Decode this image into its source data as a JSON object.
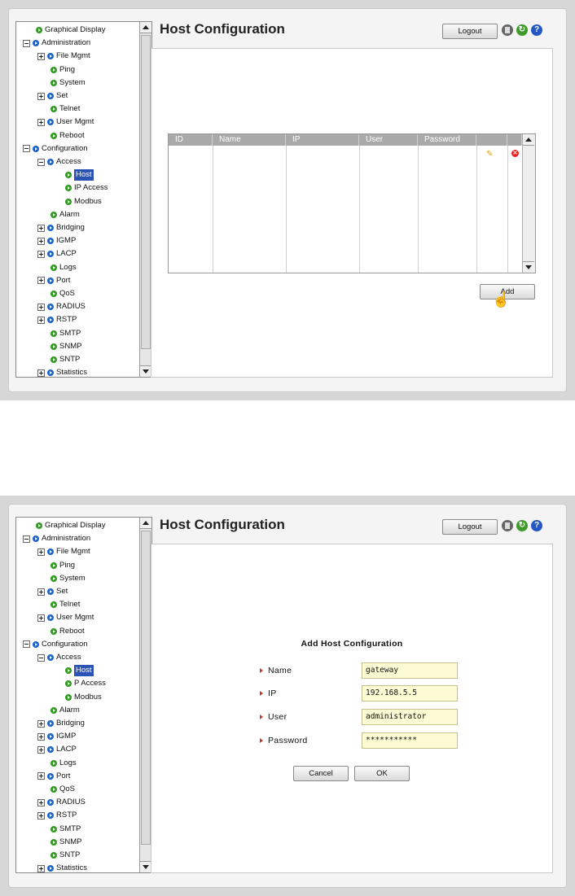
{
  "page": {
    "title": "Host Configuration",
    "logout_label": "Logout"
  },
  "tree": [
    {
      "label": "Graphical Display",
      "level": 0,
      "dot": "green"
    },
    {
      "label": "Administration",
      "level": 0,
      "dot": "blue",
      "toggle": "minus"
    },
    {
      "label": "File Mgmt",
      "level": 1,
      "dot": "blue",
      "toggle": "plus"
    },
    {
      "label": "Ping",
      "level": 1,
      "dot": "green"
    },
    {
      "label": "System",
      "level": 1,
      "dot": "green"
    },
    {
      "label": "Set",
      "level": 1,
      "dot": "blue",
      "toggle": "plus"
    },
    {
      "label": "Telnet",
      "level": 1,
      "dot": "green"
    },
    {
      "label": "User Mgmt",
      "level": 1,
      "dot": "blue",
      "toggle": "plus"
    },
    {
      "label": "Reboot",
      "level": 1,
      "dot": "green"
    },
    {
      "label": "Configuration",
      "level": 0,
      "dot": "blue",
      "toggle": "minus"
    },
    {
      "label": "Access",
      "level": 1,
      "dot": "blue",
      "toggle": "minus"
    },
    {
      "label": "Host",
      "level": 2,
      "dot": "green",
      "selected": true
    },
    {
      "label": "IP Access",
      "level": 2,
      "dot": "green"
    },
    {
      "label": "Modbus",
      "level": 2,
      "dot": "green"
    },
    {
      "label": "Alarm",
      "level": 1,
      "dot": "green"
    },
    {
      "label": "Bridging",
      "level": 1,
      "dot": "blue",
      "toggle": "plus"
    },
    {
      "label": "IGMP",
      "level": 1,
      "dot": "blue",
      "toggle": "plus"
    },
    {
      "label": "LACP",
      "level": 1,
      "dot": "blue",
      "toggle": "plus"
    },
    {
      "label": "Logs",
      "level": 1,
      "dot": "green"
    },
    {
      "label": "Port",
      "level": 1,
      "dot": "blue",
      "toggle": "plus"
    },
    {
      "label": "QoS",
      "level": 1,
      "dot": "green"
    },
    {
      "label": "RADIUS",
      "level": 1,
      "dot": "blue",
      "toggle": "plus"
    },
    {
      "label": "RSTP",
      "level": 1,
      "dot": "blue",
      "toggle": "plus"
    },
    {
      "label": "SMTP",
      "level": 1,
      "dot": "green"
    },
    {
      "label": "SNMP",
      "level": 1,
      "dot": "green"
    },
    {
      "label": "SNTP",
      "level": 1,
      "dot": "green"
    },
    {
      "label": "Statistics",
      "level": 1,
      "dot": "blue",
      "toggle": "plus"
    }
  ],
  "tree_bottom": {
    "ip_access_label": "P Access"
  },
  "table": {
    "columns": [
      "ID",
      "Name",
      "IP",
      "User",
      "Password"
    ],
    "add_label": "Add"
  },
  "form": {
    "title": "Add Host Configuration",
    "fields": [
      {
        "label": "Name",
        "value": "gateway"
      },
      {
        "label": "IP",
        "value": "192.168.5.5"
      },
      {
        "label": "User",
        "value": "administrator"
      },
      {
        "label": "Password",
        "value": "***********"
      }
    ],
    "cancel_label": "Cancel",
    "ok_label": "OK"
  },
  "icons": {
    "save": "save-icon",
    "refresh": "refresh-icon",
    "help": "help-icon",
    "edit": "pencil-icon",
    "delete": "delete-icon"
  },
  "colors": {
    "selected": "#2b52b5",
    "input_bg": "#fdfbd4",
    "header_bg": "#a9a9a9"
  }
}
